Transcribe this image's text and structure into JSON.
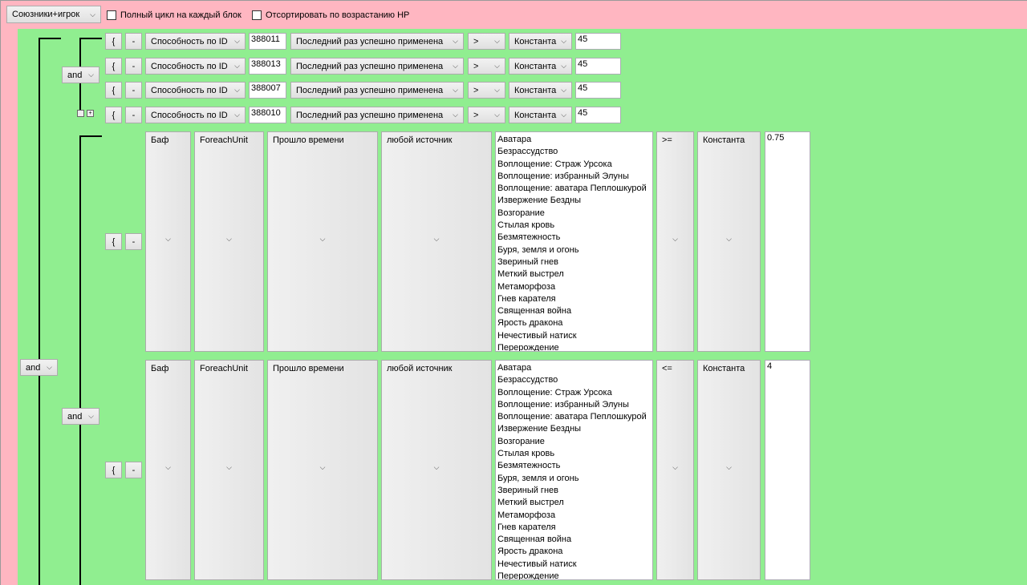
{
  "top": {
    "mode": "Союзники+игрок",
    "full_cycle": "Полный цикл на каждый блок",
    "sort_hp": "Отсортировать по возрастанию HP"
  },
  "logic": {
    "root_op": "and",
    "group1_op": "and",
    "group2_op": "and"
  },
  "brace_label": "{",
  "minus_label": "-",
  "plus_label": "+",
  "conditions": [
    {
      "type": "Способность по ID",
      "id": "388011",
      "check": "Последний раз успешно применена",
      "op": ">",
      "value_type": "Константа",
      "value": "45"
    },
    {
      "type": "Способность по ID",
      "id": "388013",
      "check": "Последний раз успешно применена",
      "op": ">",
      "value_type": "Константа",
      "value": "45"
    },
    {
      "type": "Способность по ID",
      "id": "388007",
      "check": "Последний раз успешно применена",
      "op": ">",
      "value_type": "Константа",
      "value": "45"
    },
    {
      "type": "Способность по ID",
      "id": "388010",
      "check": "Последний раз успешно применена",
      "op": ">",
      "value_type": "Константа",
      "value": "45"
    }
  ],
  "buff_rows": [
    {
      "kind": "Баф",
      "iter": "ForeachUnit",
      "metric": "Прошло времени",
      "source": "любой источник",
      "op": ">=",
      "value_type": "Константа",
      "value": "0.75"
    },
    {
      "kind": "Баф",
      "iter": "ForeachUnit",
      "metric": "Прошло времени",
      "source": "любой источник",
      "op": "<=",
      "value_type": "Константа",
      "value": "4"
    }
  ],
  "buff_list": [
    "Аватара",
    "Безрассудство",
    "Воплощение: Страж Урсока",
    "Воплощение: избранный Элуны",
    "Воплощение: аватара Пеплошкурой",
    "Извержение Бездны",
    "Возгорание",
    "Стылая кровь",
    "Безмятежность",
    "Буря, земля и огонь",
    "Звериный гнев",
    "Меткий выстрел",
    "Метаморфоза",
    "Гнев карателя",
    "Священная война",
    "Ярость дракона",
    "Нечестивый натиск",
    "Перерождение"
  ]
}
